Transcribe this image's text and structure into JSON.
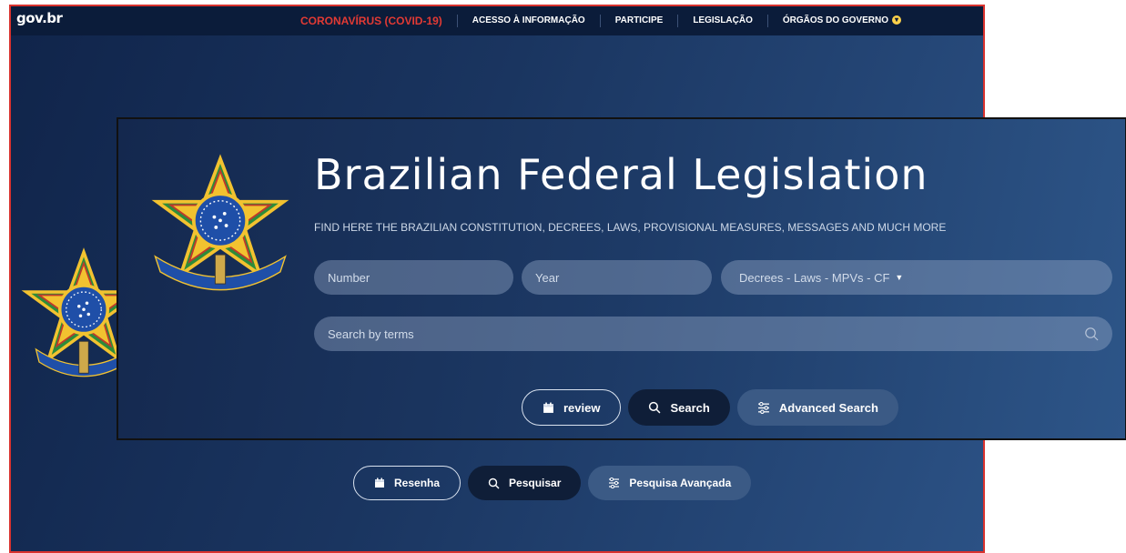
{
  "back_site": {
    "logo": "gov.br",
    "nav": [
      {
        "label": "CORONAVÍRUS (COVID-19)"
      },
      {
        "label": "ACESSO À INFORMAÇÃO"
      },
      {
        "label": "PARTICIPE"
      },
      {
        "label": "LEGISLAÇÃO"
      },
      {
        "label": "ÓRGÃOS DO GOVERNO"
      }
    ],
    "buttons": {
      "resenha": "Resenha",
      "pesquisar": "Pesquisar",
      "pesquisa_avancada": "Pesquisa Avançada"
    }
  },
  "front_site": {
    "title": "Brazilian Federal Legislation",
    "subtitle": "FIND HERE THE BRAZILIAN CONSTITUTION, DECREES, LAWS, PROVISIONAL MEASURES, MESSAGES AND MUCH MORE",
    "number_placeholder": "Number",
    "year_placeholder": "Year",
    "type_select": "Decrees - Laws - MPVs - CF",
    "search_placeholder": "Search by terms",
    "buttons": {
      "review": "review",
      "search": "Search",
      "advanced_search": "Advanced Search"
    }
  },
  "colors": {
    "accent_red": "#d9322e",
    "navy": "#0b1c3a",
    "emblem_blue": "#1f4fa8",
    "emblem_gold": "#f2c230",
    "emblem_green": "#2e8b3a"
  },
  "icons": [
    "calendar-icon",
    "search-icon",
    "sliders-icon",
    "chevron-down-icon",
    "caret-down-icon",
    "coat-of-arms-icon"
  ]
}
